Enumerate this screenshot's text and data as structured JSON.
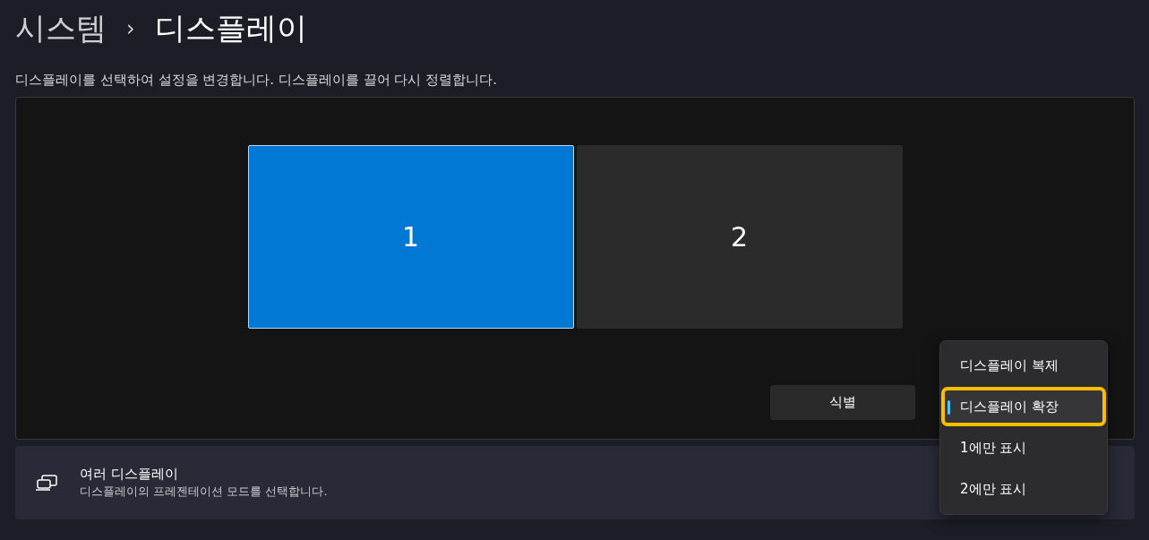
{
  "breadcrumb": {
    "parent": "시스템",
    "separator": "›",
    "current": "디스플레이"
  },
  "description": "디스플레이를 선택하여 설정을 변경합니다. 디스플레이를 끌어 다시 정렬합니다.",
  "displays": [
    {
      "label": "1",
      "selected": true
    },
    {
      "label": "2",
      "selected": false
    }
  ],
  "identify_button": "식별",
  "setting": {
    "title": "여러 디스플레이",
    "subtitle": "디스플레이의 프레젠테이션 모드를 선택합니다."
  },
  "menu": [
    {
      "label": "디스플레이 복제",
      "selected": false
    },
    {
      "label": "디스플레이 확장",
      "selected": true
    },
    {
      "label": "1에만 표시",
      "selected": false
    },
    {
      "label": "2에만 표시",
      "selected": false
    }
  ]
}
